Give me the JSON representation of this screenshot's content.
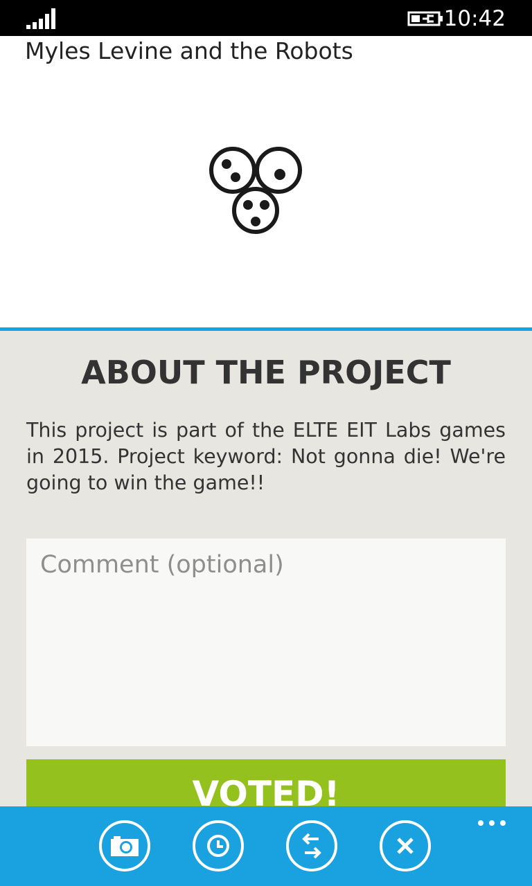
{
  "status_bar": {
    "time": "10:42",
    "icons": [
      "signal-strength-icon",
      "battery-charging-icon"
    ]
  },
  "app": {
    "title": "Myles Levine and the Robots",
    "logo_icon": "three-circles-logo"
  },
  "about": {
    "heading": "ABOUT THE PROJECT",
    "text": "This project is part of the ELTE EIT Labs games in 2015. Project keyword: Not gonna die! We're going to win the game!!"
  },
  "comment": {
    "placeholder": "Comment (optional)",
    "value": ""
  },
  "vote_button": {
    "label": "VOTED!"
  },
  "app_bar": {
    "buttons": [
      {
        "icon": "camera-icon"
      },
      {
        "icon": "clock-icon"
      },
      {
        "icon": "swap-arrows-icon"
      },
      {
        "icon": "close-icon"
      }
    ],
    "more_icon": "ellipsis-icon"
  },
  "colors": {
    "accent": "#1aa1e0",
    "panel_bg": "#e7e6e1",
    "vote_green": "#95c11f",
    "text": "#333333"
  }
}
